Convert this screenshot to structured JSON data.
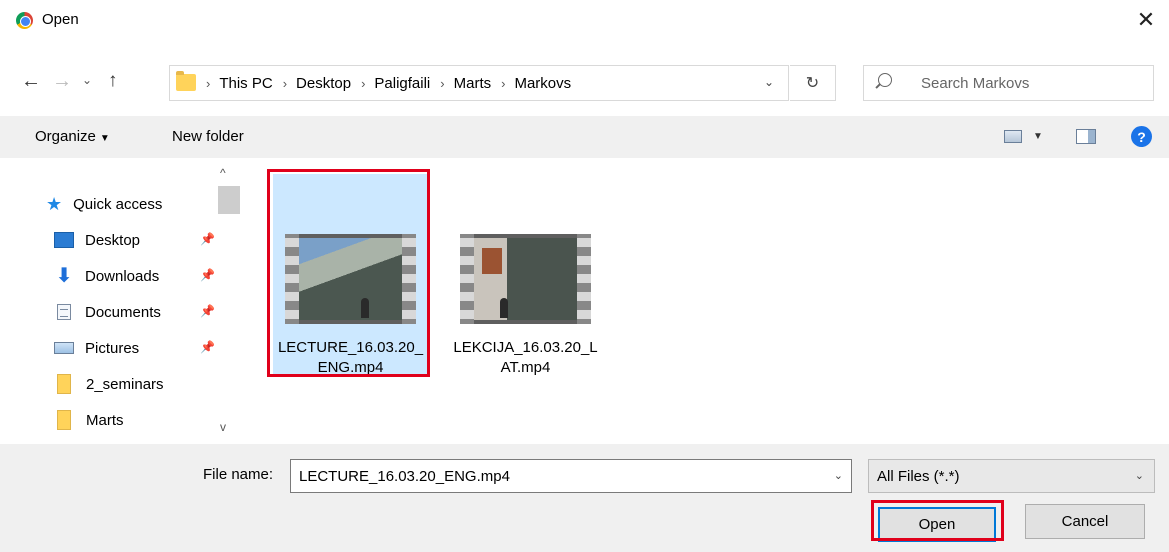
{
  "window": {
    "title": "Open",
    "app_icon": "chrome-icon",
    "close_glyph": "✕"
  },
  "nav": {
    "back": "←",
    "forward": "→",
    "recent": "⌄",
    "up": "↑",
    "breadcrumbs": [
      "This PC",
      "Desktop",
      "Paligfaili",
      "Marts",
      "Markovs"
    ],
    "separator": "›",
    "dropdown": "⌄",
    "refresh": "↻",
    "search_placeholder": "Search Markovs"
  },
  "toolbar": {
    "organize": "Organize",
    "organize_caret": "▼",
    "new_folder": "New folder",
    "view_caret": "▼",
    "help": "?"
  },
  "sidebar": {
    "items": [
      {
        "label": "Quick access",
        "icon": "star-icon",
        "pinned": false
      },
      {
        "label": "Desktop",
        "icon": "desktop-icon",
        "pinned": true
      },
      {
        "label": "Downloads",
        "icon": "download-icon",
        "pinned": true
      },
      {
        "label": "Documents",
        "icon": "documents-icon",
        "pinned": true
      },
      {
        "label": "Pictures",
        "icon": "pictures-icon",
        "pinned": true
      },
      {
        "label": "2_seminars",
        "icon": "folder-icon",
        "pinned": false
      },
      {
        "label": "Marts",
        "icon": "folder-icon",
        "pinned": false
      }
    ],
    "pin_glyph": "📌",
    "scroll_up": "^",
    "scroll_down": "v"
  },
  "files": [
    {
      "name": "LECTURE_16.03.20_ENG.mp4",
      "selected": true
    },
    {
      "name": "LEKCIJA_16.03.20_LAT.mp4",
      "selected": false
    }
  ],
  "footer": {
    "file_name_label": "File name:",
    "file_name_value": "LECTURE_16.03.20_ENG.mp4",
    "file_type": "All Files (*.*)",
    "caret": "⌄",
    "open": "Open",
    "cancel": "Cancel"
  },
  "colors": {
    "highlight": "#e0001b",
    "selection": "#cce8ff",
    "accent": "#0078d7"
  }
}
